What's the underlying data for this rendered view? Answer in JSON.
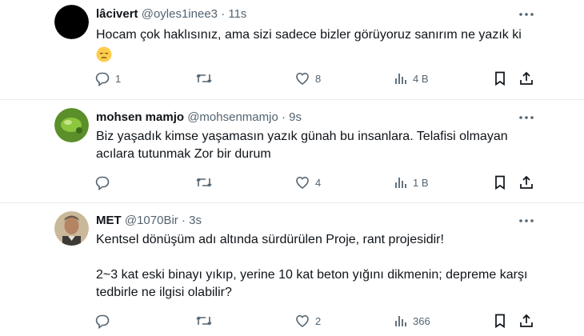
{
  "tweets": [
    {
      "name": "lâcivert",
      "handle": "@oyles1inee3",
      "sep": "·",
      "time": "11s",
      "text_lines": [
        "Hocam çok haklısınız, ama sizi sadece bizler görüyoruz sanırım ne yazık ki"
      ],
      "emoji": "pensive-face",
      "replies": "1",
      "retweets": "",
      "likes": "8",
      "views": "4 B"
    },
    {
      "name": "mohsen mamjo",
      "handle": "@mohsenmamjo",
      "sep": "·",
      "time": "9s",
      "text_lines": [
        "Biz yaşadık kimse yaşamasın yazık günah bu insanlara. Telafisi olmayan",
        "acılara tutunmak Zor bir durum"
      ],
      "replies": "",
      "retweets": "",
      "likes": "4",
      "views": "1 B"
    },
    {
      "name": "MET",
      "handle": "@1070Bir",
      "sep": "·",
      "time": "3s",
      "text_lines": [
        "Kentsel dönüşüm adı altında sürdürülen Proje, rant projesidir!",
        "",
        "2~3 kat eski binayı yıkıp, yerine 10 kat beton yığını dikmenin; depreme karşı",
        "tedbirle ne ilgisi olabilir?"
      ],
      "replies": "",
      "retweets": "",
      "likes": "2",
      "views": "366"
    }
  ],
  "colors": {
    "text": "#0f1419",
    "secondary": "#536471",
    "divider": "#e6ecf0"
  },
  "icons": [
    "reply-icon",
    "retweet-icon",
    "like-icon",
    "views-icon",
    "bookmark-icon",
    "share-icon",
    "more-icon"
  ]
}
